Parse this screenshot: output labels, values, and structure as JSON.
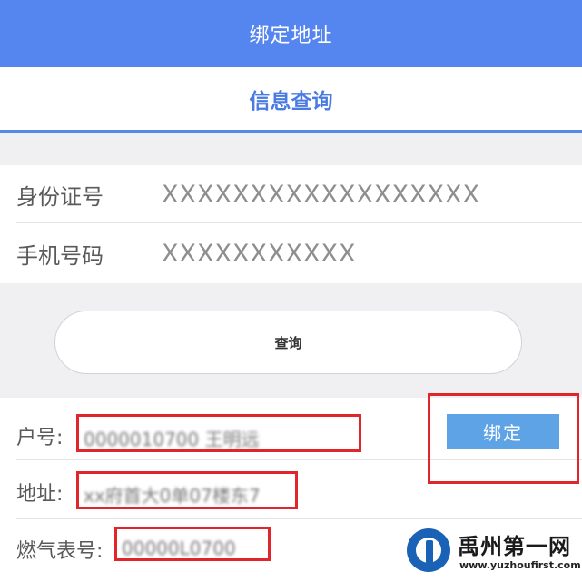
{
  "header": {
    "title": "绑定地址"
  },
  "subheader": {
    "title": "信息查询"
  },
  "form": {
    "id_label": "身份证号",
    "id_value": "XXXXXXXXXXXXXXXXXX",
    "phone_label": "手机号码",
    "phone_value": "XXXXXXXXXXX"
  },
  "query_button": {
    "label": "查询"
  },
  "result": {
    "account_label": "户号:",
    "address_label": "地址:",
    "meter_label": "燃气表号:",
    "account_value_masked": "0000010700   王明远",
    "address_value_masked": "xx府首大0单07楼东7",
    "meter_value_masked": "00000L0700"
  },
  "bind_button": {
    "label": "绑定"
  },
  "watermark": {
    "title": "禹州第一网",
    "url": "www.yuzhoufirst.com"
  },
  "colors": {
    "header_bg": "#5585ee",
    "accent": "#4a7be3",
    "bind_button_bg": "#5ea3e6",
    "highlight_box": "#e0252b"
  }
}
